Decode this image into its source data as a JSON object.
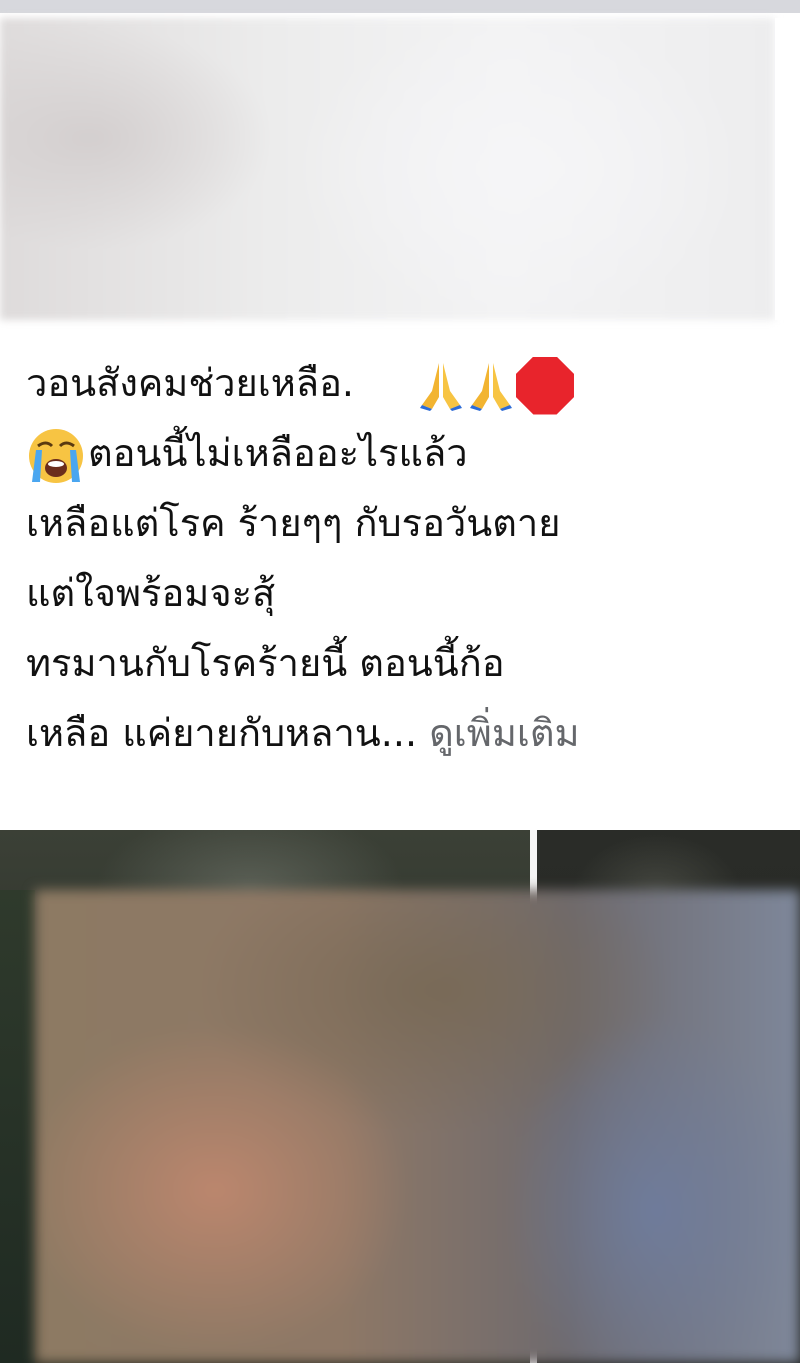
{
  "post": {
    "lines": [
      "วอนสังคมช่วยเหลือ.",
      "ตอนนี้ไม่เหลืออะไรแล้ว",
      "เหลือแต่โรค ร้ายๆๆ กับรอวันตาย",
      "แต่ใจพร้อมจะสุ้",
      "ทรมานกับโรคร้ายนี้  ตอนนี้ก้อ",
      "เหลือ แค่ยายกับหลาน..."
    ],
    "see_more_label": "ดูเพิ่มเติม"
  },
  "icons": {
    "line1": [
      "folded-hands-icon",
      "folded-hands-icon",
      "stop-sign-icon"
    ],
    "line2": [
      "crying-face-icon"
    ]
  },
  "colors": {
    "text": "#111111",
    "see_more": "#65676b",
    "stop_sign": "#e8242c",
    "hands": "#f2b431"
  }
}
